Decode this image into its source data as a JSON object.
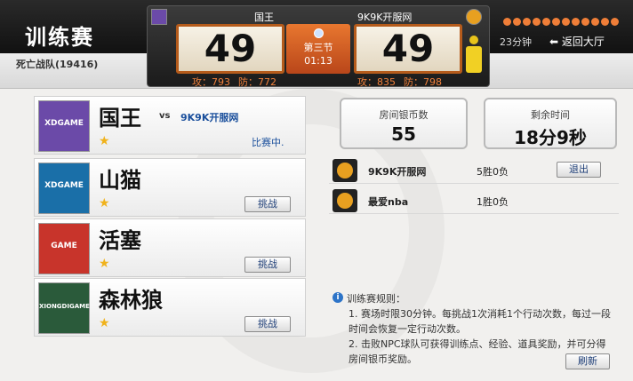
{
  "header": {
    "title": "训练赛",
    "team_info": "死亡战队(19416)"
  },
  "scoreboard": {
    "home_name": "国王",
    "away_name": "9K9K开服网",
    "home_score": "49",
    "away_score": "49",
    "period": "第三节",
    "clock": "01:13",
    "home_attack": "攻：793",
    "home_defense": "防：772",
    "away_attack": "攻：835",
    "away_defense": "防：798"
  },
  "topright": {
    "minutes_left": "23分钟",
    "back_label": "返回大厅"
  },
  "teams": [
    {
      "name": "国王",
      "logo_text": "XDGAME",
      "status": "比赛中.",
      "vs": "vs",
      "opponent": "9K9K开服网",
      "logo_color": "#6b4aa8"
    },
    {
      "name": "山猫",
      "logo_text": "XDGAME",
      "button": "挑战",
      "logo_color": "#1a6fa8"
    },
    {
      "name": "活塞",
      "logo_text": "GAME",
      "button": "挑战",
      "logo_color": "#c8342b"
    },
    {
      "name": "森林狼",
      "logo_text": "XIONGDIGAME",
      "button": "挑战",
      "logo_color": "#2a5a3a"
    }
  ],
  "room": {
    "coins_label": "房间银币数",
    "coins_value": "55",
    "time_label": "剩余时间",
    "time_value": "18分9秒"
  },
  "players": [
    {
      "name": "9K9K开服网",
      "record": "5胜0负",
      "button": "退出"
    },
    {
      "name": "最爱nba",
      "record": "1胜0负"
    }
  ],
  "rules": {
    "title": "训练赛规则：",
    "items": [
      "1. 赛场时限30分钟。每挑战1次消耗1个行动次数，每过一段时间会恢复一定行动次数。",
      "2. 击败NPC球队可获得训练点、经验、道具奖励，并可分得房间银币奖励。"
    ],
    "refresh_label": "刷新"
  },
  "colors": {
    "accent": "#ef7e38",
    "link": "#1f3f78"
  }
}
